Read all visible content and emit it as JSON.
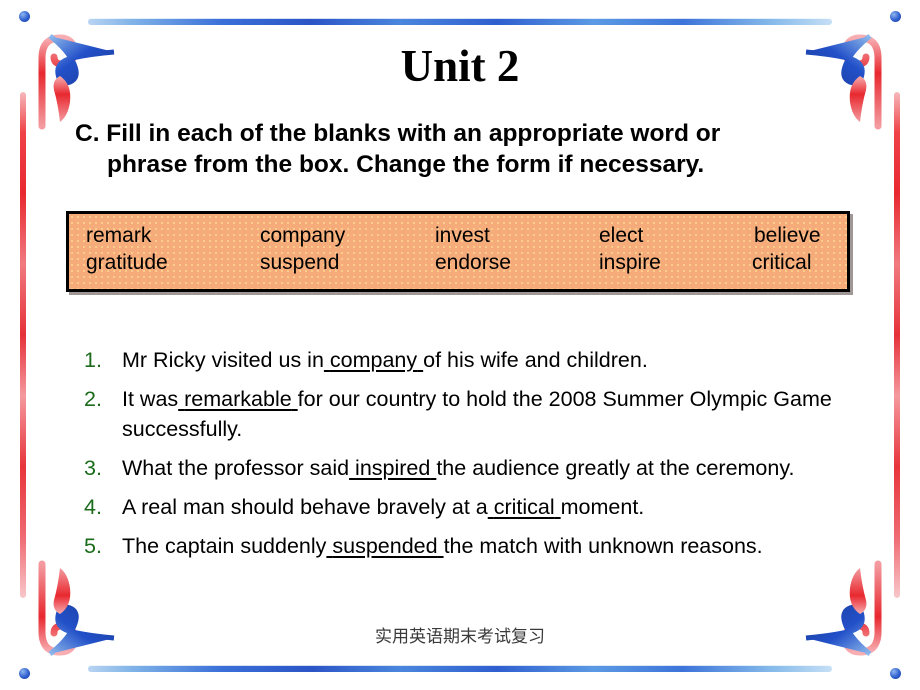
{
  "slide": {
    "title": "Unit 2",
    "footer": "实用英语期末考试复习",
    "accent_orange": "#f5ab7a",
    "accent_green": "#1a6b1a",
    "border_blue": "#2f5fcf",
    "border_red": "#e8282f"
  },
  "instruction": {
    "line1": "C. Fill in each of the blanks with an appropriate word or",
    "line2": "phrase from the box. Change the form if necessary."
  },
  "wordbox": {
    "row1": [
      "remark",
      "company",
      "invest",
      "elect",
      "believe"
    ],
    "row2": [
      "gratitude",
      "suspend",
      "endorse",
      "inspire",
      "critical"
    ]
  },
  "questions": [
    {
      "number": "1.",
      "before": "Mr Ricky visited us in",
      "answer": "company",
      "after": "of his wife and children."
    },
    {
      "number": "2.",
      "before": "It was",
      "answer": "remarkable",
      "after": "for our country to hold the 2008 Summer Olympic Game successfully."
    },
    {
      "number": "3.",
      "before": "What the professor said",
      "answer": "inspired",
      "after": "the audience greatly at the ceremony."
    },
    {
      "number": "4.",
      "before": "A real man should behave bravely at a",
      "answer": "critical",
      "after": "moment."
    },
    {
      "number": "5.",
      "before": "The captain suddenly",
      "answer": "suspended",
      "after": "the match with unknown reasons."
    }
  ]
}
